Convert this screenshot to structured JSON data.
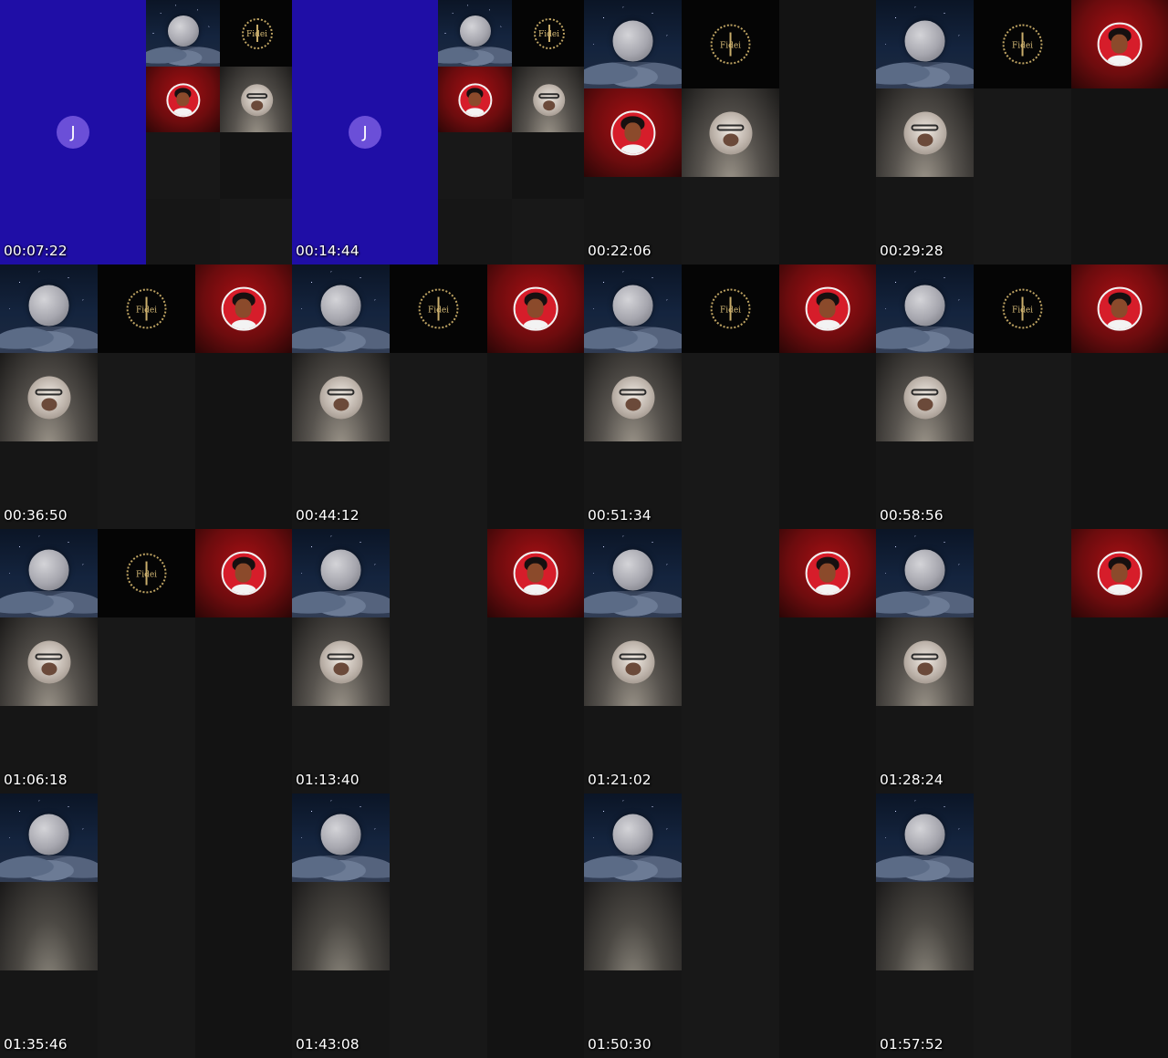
{
  "contact_sheet": {
    "thumbnails": [
      {
        "timestamp": "00:07:22",
        "layout": "purple-sidebar",
        "avatar_initial": "J",
        "tiles": [
          "moon",
          "logo",
          "avatar",
          "selfie",
          "dark",
          "dark",
          "dark",
          "dark"
        ]
      },
      {
        "timestamp": "00:14:44",
        "layout": "purple-sidebar",
        "avatar_initial": "J",
        "tiles": [
          "moon",
          "logo",
          "avatar",
          "selfie",
          "dark",
          "dark",
          "dark",
          "dark"
        ]
      },
      {
        "timestamp": "00:22:06",
        "layout": "grid3",
        "tiles": [
          "moon",
          "logo",
          "dark",
          "avatar",
          "selfie",
          "dark",
          "dark",
          "dark",
          "dark"
        ]
      },
      {
        "timestamp": "00:29:28",
        "layout": "grid3",
        "tiles": [
          "moon",
          "logo",
          "avatar",
          "selfie",
          "dark",
          "dark",
          "dark",
          "dark",
          "dark"
        ]
      },
      {
        "timestamp": "00:36:50",
        "layout": "grid3",
        "tiles": [
          "moon",
          "logo",
          "avatar",
          "selfie",
          "dark",
          "dark",
          "dark",
          "dark",
          "dark"
        ]
      },
      {
        "timestamp": "00:44:12",
        "layout": "grid3",
        "tiles": [
          "moon",
          "logo",
          "avatar",
          "selfie",
          "dark",
          "dark",
          "dark",
          "dark",
          "dark"
        ]
      },
      {
        "timestamp": "00:51:34",
        "layout": "grid3",
        "tiles": [
          "moon",
          "logo",
          "avatar",
          "selfie",
          "dark",
          "dark",
          "dark",
          "dark",
          "dark"
        ]
      },
      {
        "timestamp": "00:58:56",
        "layout": "grid3",
        "tiles": [
          "moon",
          "logo",
          "avatar",
          "selfie",
          "dark",
          "dark",
          "dark",
          "dark",
          "dark"
        ]
      },
      {
        "timestamp": "01:06:18",
        "layout": "grid3",
        "tiles": [
          "moon",
          "logo",
          "avatar",
          "selfie",
          "dark",
          "dark",
          "dark",
          "dark",
          "dark"
        ]
      },
      {
        "timestamp": "01:13:40",
        "layout": "grid3",
        "tiles": [
          "moon",
          "dark",
          "avatar",
          "selfie",
          "dark",
          "dark",
          "dark",
          "dark",
          "dark"
        ]
      },
      {
        "timestamp": "01:21:02",
        "layout": "grid3",
        "tiles": [
          "moon",
          "dark",
          "avatar",
          "selfie",
          "dark",
          "dark",
          "dark",
          "dark",
          "dark"
        ]
      },
      {
        "timestamp": "01:28:24",
        "layout": "grid3",
        "tiles": [
          "moon",
          "dark",
          "avatar",
          "selfie",
          "dark",
          "dark",
          "dark",
          "dark",
          "dark"
        ]
      },
      {
        "timestamp": "01:35:46",
        "layout": "grid3",
        "tiles": [
          "moon",
          "dark",
          "dark",
          "selfie-blank",
          "dark",
          "dark",
          "dark",
          "dark",
          "dark"
        ]
      },
      {
        "timestamp": "01:43:08",
        "layout": "grid3",
        "tiles": [
          "moon",
          "dark",
          "dark",
          "selfie-blank",
          "dark",
          "dark",
          "dark",
          "dark",
          "dark"
        ]
      },
      {
        "timestamp": "01:50:30",
        "layout": "grid3",
        "tiles": [
          "moon",
          "dark",
          "dark",
          "selfie-blank",
          "dark",
          "dark",
          "dark",
          "dark",
          "dark"
        ]
      },
      {
        "timestamp": "01:57:52",
        "layout": "grid3",
        "tiles": [
          "moon",
          "dark",
          "dark",
          "selfie-blank",
          "dark",
          "dark",
          "dark",
          "dark",
          "dark"
        ]
      }
    ],
    "logo_text": "Fidei",
    "colors": {
      "purple": "#1f0ea6",
      "avatar_red": "#a80f14",
      "background": "#111111"
    }
  }
}
